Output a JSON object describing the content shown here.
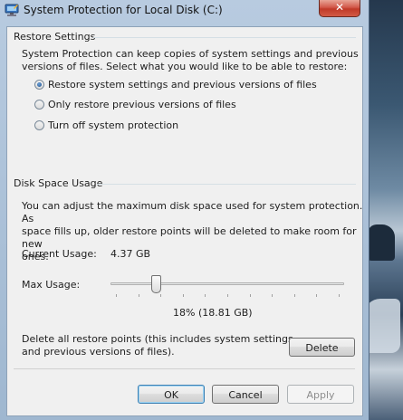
{
  "window": {
    "title": "System Protection for Local Disk (C:)",
    "close_glyph": "✕"
  },
  "restore_settings": {
    "header": "Restore Settings",
    "description_line1": "System Protection can keep copies of system settings and previous",
    "description_line2": "versions of files. Select what you would like to be able to restore:",
    "options": [
      {
        "label": "Restore system settings and previous versions of files",
        "checked": true
      },
      {
        "label": "Only restore previous versions of files",
        "checked": false
      },
      {
        "label": "Turn off system protection",
        "checked": false
      }
    ]
  },
  "disk_space": {
    "header": "Disk Space Usage",
    "description_line1": "You can adjust the maximum disk space used for system protection. As",
    "description_line2": "space fills up, older restore points will be deleted to make room for new",
    "description_line3": "ones.",
    "current_usage_label": "Current Usage:",
    "current_usage_value": "4.37 GB",
    "max_usage_label": "Max Usage:",
    "max_usage_percent": 18,
    "max_usage_text": "18% (18.81 GB)",
    "delete_text_line1": "Delete all restore points (this includes system settings",
    "delete_text_line2": "and previous versions of files).",
    "delete_button": "Delete"
  },
  "footer": {
    "ok": "OK",
    "cancel": "Cancel",
    "apply": "Apply"
  },
  "icons": {
    "app": "system-protection-icon",
    "close": "close-icon"
  }
}
